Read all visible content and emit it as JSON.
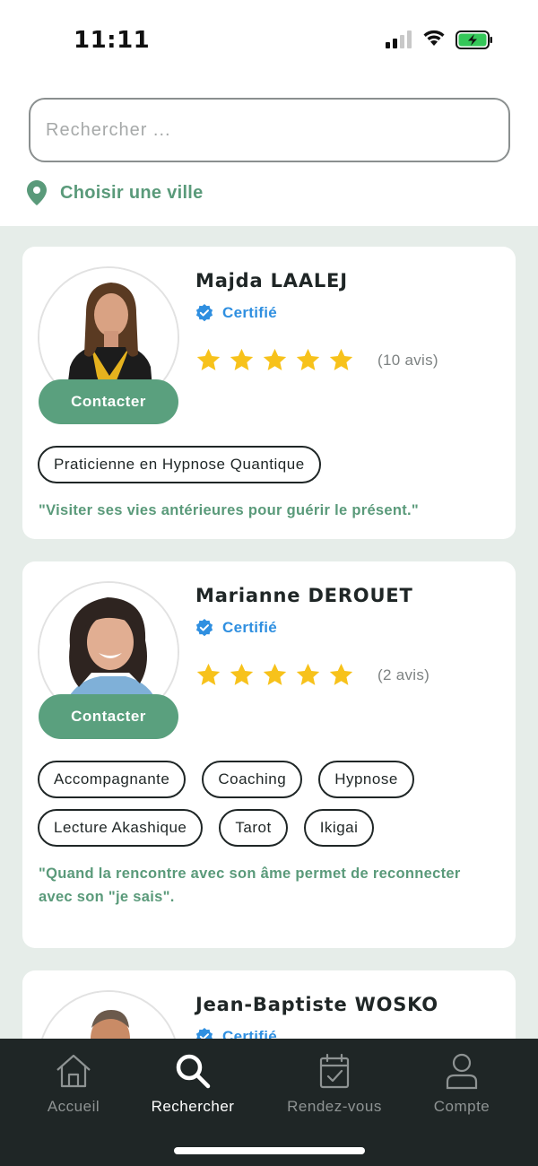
{
  "status_bar": {
    "time": "11:11"
  },
  "search": {
    "placeholder": "Rechercher ..."
  },
  "city": {
    "label": "Choisir une ville"
  },
  "cards": [
    {
      "name": "Majda LAALEJ",
      "certified_label": "Certifié",
      "rating": 5,
      "reviews": "(10 avis)",
      "contact_label": "Contacter",
      "tags": [
        "Praticienne en Hypnose Quantique"
      ],
      "quote": "\"Visiter ses vies antérieures pour guérir le présent.\""
    },
    {
      "name": "Marianne DEROUET",
      "certified_label": "Certifié",
      "rating": 5,
      "reviews": "(2 avis)",
      "contact_label": "Contacter",
      "tags": [
        "Accompagnante",
        "Coaching",
        "Hypnose",
        "Lecture Akashique",
        "Tarot",
        "Ikigai"
      ],
      "quote": "\"Quand la rencontre avec son âme permet de reconnecter avec son \"je sais\"."
    },
    {
      "name": "Jean-Baptiste WOSKO",
      "certified_label": "Certifié"
    }
  ],
  "nav": {
    "items": [
      {
        "label": "Accueil",
        "icon": "home-icon"
      },
      {
        "label": "Rechercher",
        "icon": "search-icon"
      },
      {
        "label": "Rendez-vous",
        "icon": "calendar-check-icon"
      },
      {
        "label": "Compte",
        "icon": "user-icon"
      }
    ],
    "active": "Rechercher"
  },
  "colors": {
    "accent_green": "#5aa07e",
    "certified_blue": "#2f8fe0",
    "star_yellow": "#f7c21b",
    "nav_background": "#1f2626",
    "list_background": "#e6ede9"
  }
}
